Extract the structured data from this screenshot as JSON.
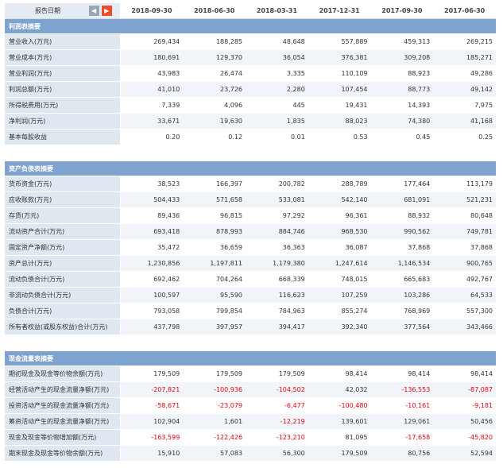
{
  "header": {
    "label": "报告日期",
    "prev_icon": "chevron-left-icon",
    "next_icon": "chevron-right-icon",
    "prev_glyph": "◀",
    "next_glyph": "▶",
    "dates": [
      "2018-09-30",
      "2018-06-30",
      "2018-03-31",
      "2017-12-31",
      "2017-09-30",
      "2017-06-30"
    ]
  },
  "sections": [
    {
      "title": "利润表摘要",
      "rows": [
        {
          "label": "营业收入(万元)",
          "values": [
            "269,434",
            "188,285",
            "48,648",
            "557,889",
            "459,313",
            "269,215"
          ]
        },
        {
          "label": "营业成本(万元)",
          "values": [
            "180,691",
            "129,370",
            "36,054",
            "376,381",
            "309,208",
            "185,271"
          ]
        },
        {
          "label": "营业利润(万元)",
          "values": [
            "43,983",
            "26,474",
            "3,335",
            "110,109",
            "88,923",
            "49,286"
          ]
        },
        {
          "label": "利润总额(万元)",
          "values": [
            "41,010",
            "23,726",
            "2,280",
            "107,454",
            "88,773",
            "49,142"
          ]
        },
        {
          "label": "所得税费用(万元)",
          "values": [
            "7,339",
            "4,096",
            "445",
            "19,431",
            "14,393",
            "7,975"
          ]
        },
        {
          "label": "净利润(万元)",
          "values": [
            "33,671",
            "19,630",
            "1,835",
            "88,023",
            "74,380",
            "41,168"
          ]
        },
        {
          "label": "基本每股收益",
          "values": [
            "0.20",
            "0.12",
            "0.01",
            "0.53",
            "0.45",
            "0.25"
          ]
        }
      ]
    },
    {
      "title": "资产负债表摘要",
      "rows": [
        {
          "label": "货币资金(万元)",
          "values": [
            "38,523",
            "166,397",
            "200,782",
            "288,789",
            "177,464",
            "113,179"
          ]
        },
        {
          "label": "应收账款(万元)",
          "values": [
            "504,433",
            "571,658",
            "533,081",
            "542,140",
            "681,091",
            "521,231"
          ]
        },
        {
          "label": "存货(万元)",
          "values": [
            "89,436",
            "96,815",
            "97,292",
            "96,361",
            "88,932",
            "80,648"
          ]
        },
        {
          "label": "流动资产合计(万元)",
          "values": [
            "693,418",
            "878,993",
            "884,746",
            "968,530",
            "990,562",
            "749,781"
          ]
        },
        {
          "label": "固定资产净额(万元)",
          "values": [
            "35,472",
            "36,659",
            "36,363",
            "36,087",
            "37,868",
            "37,868"
          ]
        },
        {
          "label": "资产总计(万元)",
          "values": [
            "1,230,856",
            "1,197,811",
            "1,179,380",
            "1,247,614",
            "1,146,534",
            "900,765"
          ]
        },
        {
          "label": "流动负债合计(万元)",
          "values": [
            "692,462",
            "704,264",
            "668,339",
            "748,015",
            "665,683",
            "492,767"
          ]
        },
        {
          "label": "非流动负债合计(万元)",
          "values": [
            "100,597",
            "95,590",
            "116,623",
            "107,259",
            "103,286",
            "64,533"
          ]
        },
        {
          "label": "负债合计(万元)",
          "values": [
            "793,058",
            "799,854",
            "784,963",
            "855,274",
            "768,969",
            "557,300"
          ]
        },
        {
          "label": "所有者权益(或股东权益)合计(万元)",
          "values": [
            "437,798",
            "397,957",
            "394,417",
            "392,340",
            "377,564",
            "343,466"
          ]
        }
      ]
    },
    {
      "title": "现金流量表摘要",
      "rows": [
        {
          "label": "期初现金及现金等价物余额(万元)",
          "values": [
            "179,509",
            "179,509",
            "179,509",
            "98,414",
            "98,414",
            "98,414"
          ]
        },
        {
          "label": "经营活动产生的现金流量净额(万元)",
          "values": [
            "-207,821",
            "-100,936",
            "-104,502",
            "42,032",
            "-136,553",
            "-87,087"
          ]
        },
        {
          "label": "投资活动产生的现金流量净额(万元)",
          "values": [
            "-58,671",
            "-23,079",
            "-6,477",
            "-100,480",
            "-10,161",
            "-9,181"
          ]
        },
        {
          "label": "筹资活动产生的现金流量净额(万元)",
          "values": [
            "102,904",
            "1,601",
            "-12,219",
            "139,601",
            "129,061",
            "50,456"
          ]
        },
        {
          "label": "现金及现金等价物增加额(万元)",
          "values": [
            "-163,599",
            "-122,426",
            "-123,210",
            "81,095",
            "-17,658",
            "-45,820"
          ]
        },
        {
          "label": "期末现金及现金等价物余额(万元)",
          "values": [
            "15,910",
            "57,083",
            "56,300",
            "179,509",
            "80,756",
            "52,594"
          ]
        }
      ]
    }
  ]
}
